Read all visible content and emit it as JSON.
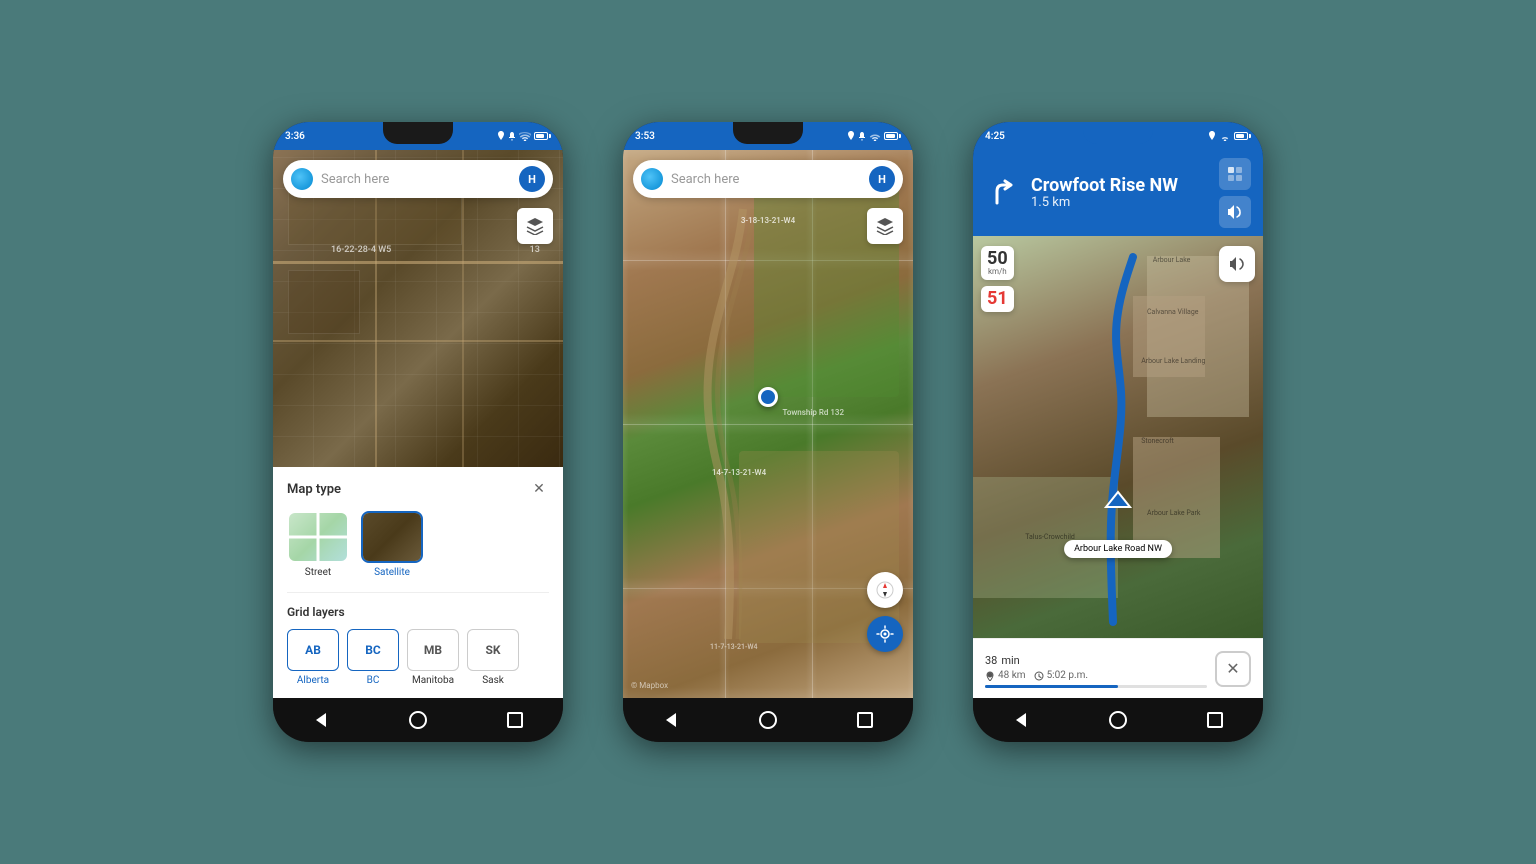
{
  "phone1": {
    "status_time": "3:36",
    "search_placeholder": "Search here",
    "avatar_label": "H",
    "map_label_1": "16-22-28-4 W5",
    "map_label_2": "13",
    "panel": {
      "title": "Map type",
      "street_label": "Street",
      "satellite_label": "Satellite",
      "grid_title": "Grid layers",
      "grid_items": [
        {
          "abbr": "AB",
          "label": "Alberta",
          "selected": true
        },
        {
          "abbr": "BC",
          "label": "BC",
          "selected": true
        },
        {
          "abbr": "MB",
          "label": "Manitoba",
          "selected": false
        },
        {
          "abbr": "SK",
          "label": "Sask",
          "selected": false
        }
      ]
    }
  },
  "phone2": {
    "status_time": "3:53",
    "search_placeholder": "Search here",
    "avatar_label": "H",
    "grid_label_top": "3-18-13-21-W4",
    "grid_label_mid": "Township Rd 132",
    "grid_label_bot": "14-7-13-21-W4",
    "grid_label_bot2": "11-7-13-21-W4",
    "mapbox_attr": "© Mapbox"
  },
  "phone3": {
    "status_time": "4:25",
    "nav_street": "Crowfoot Rise NW",
    "nav_distance": "1.5 km",
    "speed_limit": "50",
    "speed_limit_unit": "km/h",
    "current_speed": "51",
    "location_label": "Arbour Lake Road NW",
    "eta_time": "38",
    "eta_unit": "min",
    "eta_distance": "48 km",
    "eta_arrival": "5:02 p.m."
  }
}
